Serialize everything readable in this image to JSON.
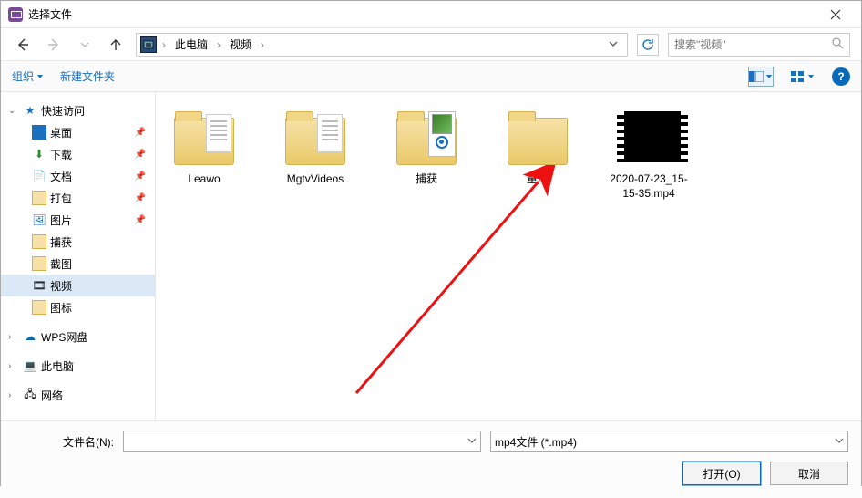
{
  "window": {
    "title": "选择文件"
  },
  "nav": {
    "breadcrumb": [
      "此电脑",
      "视频"
    ],
    "search_placeholder": "搜索\"视频\""
  },
  "toolbar": {
    "organize": "组织",
    "new_folder": "新建文件夹"
  },
  "sidebar": {
    "quick_access": "快速访问",
    "items_pinned": [
      {
        "label": "桌面"
      },
      {
        "label": "下载"
      },
      {
        "label": "文档"
      },
      {
        "label": "打包"
      },
      {
        "label": "图片"
      },
      {
        "label": "捕获"
      },
      {
        "label": "截图"
      },
      {
        "label": "视频",
        "selected": true
      },
      {
        "label": "图标"
      }
    ],
    "wps": "WPS网盘",
    "this_pc": "此电脑",
    "network": "网络"
  },
  "items": [
    {
      "name": "Leawo",
      "type": "folder"
    },
    {
      "name": "MgtvVideos",
      "type": "folder"
    },
    {
      "name": "捕获",
      "type": "folder-capture"
    },
    {
      "name": "量产",
      "type": "folder"
    },
    {
      "name": "2020-07-23_15-15-35.mp4",
      "type": "video"
    }
  ],
  "footer": {
    "filename_label": "文件名(N):",
    "filename_value": "",
    "filter": "mp4文件 (*.mp4)",
    "open": "打开(O)",
    "cancel": "取消"
  }
}
